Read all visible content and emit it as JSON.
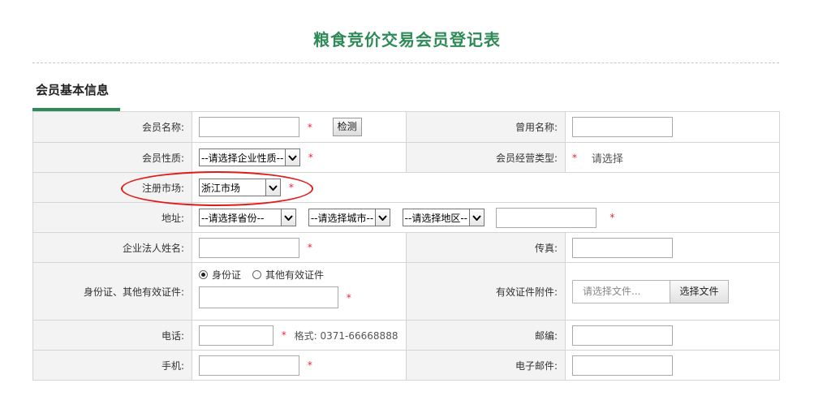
{
  "page": {
    "title": "粮食竞价交易会员登记表"
  },
  "section": {
    "title": "会员基本信息"
  },
  "form": {
    "member_name": {
      "label": "会员名称:",
      "value": "",
      "required": "*",
      "check_button": "检测"
    },
    "former_name": {
      "label": "曾用名称:",
      "value": ""
    },
    "member_nature": {
      "label": "会员性质:",
      "selected": "--请选择企业性质--",
      "required": "*"
    },
    "business_type": {
      "label": "会员经营类型:",
      "required": "*",
      "value": "请选择"
    },
    "market": {
      "label": "注册市场:",
      "selected": "浙江市场",
      "required": "*"
    },
    "address": {
      "label": "地址:",
      "province": "--请选择省份--",
      "city": "--请选择城市--",
      "district": "--请选择地区--",
      "detail": "",
      "required": "*"
    },
    "legal_name": {
      "label": "企业法人姓名:",
      "value": "",
      "required": "*"
    },
    "fax": {
      "label": "传真:",
      "value": ""
    },
    "id_type": {
      "label": "身份证、其他有效证件:",
      "option_id": "身份证",
      "option_other": "其他有效证件",
      "selected": "身份证",
      "value": "",
      "required": "*"
    },
    "attachment": {
      "label": "有效证件附件:",
      "placeholder": "请选择文件...",
      "button": "选择文件"
    },
    "phone": {
      "label": "电话:",
      "value": "",
      "required": "*",
      "format_hint": "格式: 0371-66668888"
    },
    "postcode": {
      "label": "邮编:",
      "value": ""
    },
    "mobile": {
      "label": "手机:",
      "value": "",
      "required": "*"
    },
    "email": {
      "label": "电子邮件:",
      "value": ""
    }
  },
  "colors": {
    "accent": "#2e8b57",
    "required": "#e23322",
    "highlight": "#e21a1a"
  },
  "icons": {
    "select_arrow": "chevron-down-icon",
    "radio": "radio-icon"
  }
}
